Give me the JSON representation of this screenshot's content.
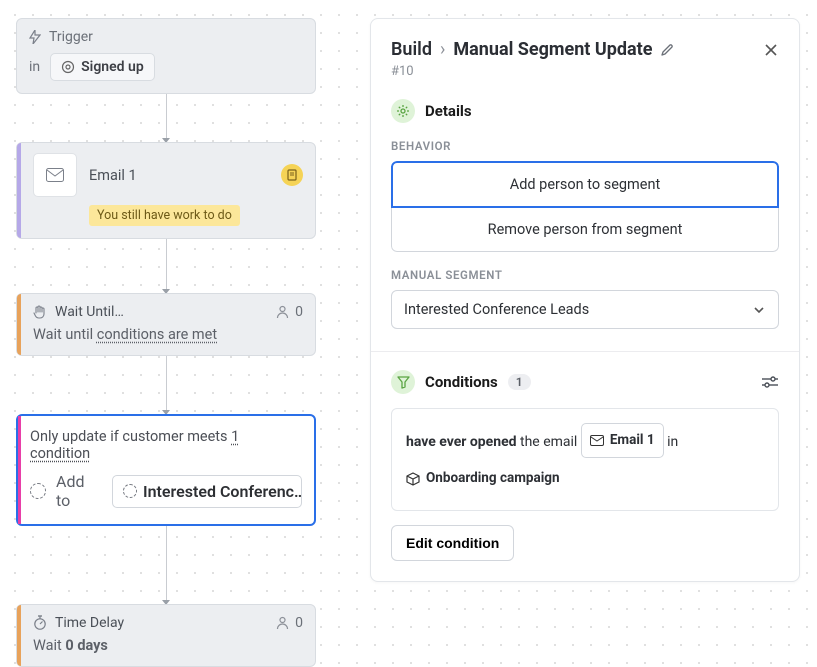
{
  "canvas": {
    "trigger": {
      "label": "Trigger",
      "prefix": "in",
      "event": "Signed up"
    },
    "email": {
      "title": "Email 1",
      "subtitle": "You still have work to do"
    },
    "wait": {
      "title": "Wait Until…",
      "subtitle_prefix": "Wait until ",
      "subtitle_link": "conditions are met",
      "count": "0"
    },
    "segment": {
      "line1_prefix": "Only update if customer meets ",
      "line1_link": "1 condition",
      "add_to": "Add to",
      "chip": "Interested Conferenc…"
    },
    "delay": {
      "title": "Time Delay",
      "subtitle_prefix": "Wait ",
      "subtitle_value": "0 days",
      "count": "0"
    }
  },
  "panel": {
    "breadcrumb1": "Build",
    "breadcrumb2": "Manual Segment Update",
    "id": "#10",
    "details_label": "Details",
    "behavior_label": "BEHAVIOR",
    "behavior_add": "Add person to segment",
    "behavior_remove": "Remove person from segment",
    "segment_label": "MANUAL SEGMENT",
    "segment_value": "Interested Conference Leads",
    "conditions_label": "Conditions",
    "conditions_count": "1",
    "cond_text_1": "have ever opened",
    "cond_text_2": " the email ",
    "cond_chip_email": "Email 1",
    "cond_text_3": " in",
    "cond_chip_campaign": "Onboarding campaign",
    "edit_btn": "Edit condition"
  }
}
